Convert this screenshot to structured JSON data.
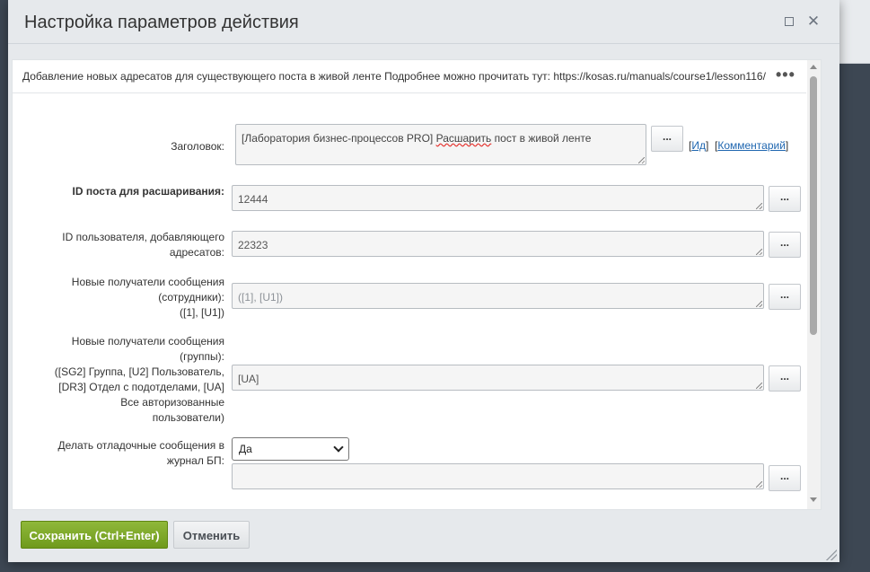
{
  "dialog": {
    "title": "Настройка параметров действия"
  },
  "description": "Добавление новых адресатов для существующего поста в живой ленте Подробнее можно прочитать тут: https://kosas.ru/manuals/course1/lesson116/",
  "description_menu": "•••",
  "fields": {
    "title": {
      "label": "Заголовок:",
      "value_part1": "[Лаборатория бизнес-процессов PRO] ",
      "value_misspelled": "Расшарить",
      "value_part2": " пост в живой ленте",
      "dots": "...",
      "link_open": "[",
      "link_id": "Ид",
      "link_sep": "]  [",
      "link_comment": "Комментарий",
      "link_close": "]"
    },
    "post_id": {
      "label": "ID поста для расшаривания:",
      "value": "12444",
      "dots": "..."
    },
    "user_id": {
      "label_line1": "ID пользователя, добавляющего",
      "label_line2": "адресатов:",
      "value": "22323",
      "dots": "..."
    },
    "recipients_employees": {
      "label_line1": "Новые получатели сообщения",
      "label_line2": "(сотрудники):",
      "label_line3": "([1], [U1])",
      "placeholder": "([1], [U1])",
      "dots": "..."
    },
    "recipients_groups": {
      "label_line1": "Новые получатели сообщения",
      "label_line2": "(группы):",
      "label_line3": "([SG2] Группа, [U2] Пользователь,",
      "label_line4": "[DR3] Отдел с подотделами, [UA]",
      "label_line5": "Все авторизованные",
      "label_line6": "пользователи)",
      "value": "[UA]",
      "dots": "..."
    },
    "debug": {
      "label_line1": "Делать отладочные сообщения в",
      "label_line2": "журнал БП:",
      "selected": "Да",
      "dots": "..."
    }
  },
  "buttons": {
    "save": "Сохранить (Ctrl+Enter)",
    "cancel": "Отменить"
  }
}
